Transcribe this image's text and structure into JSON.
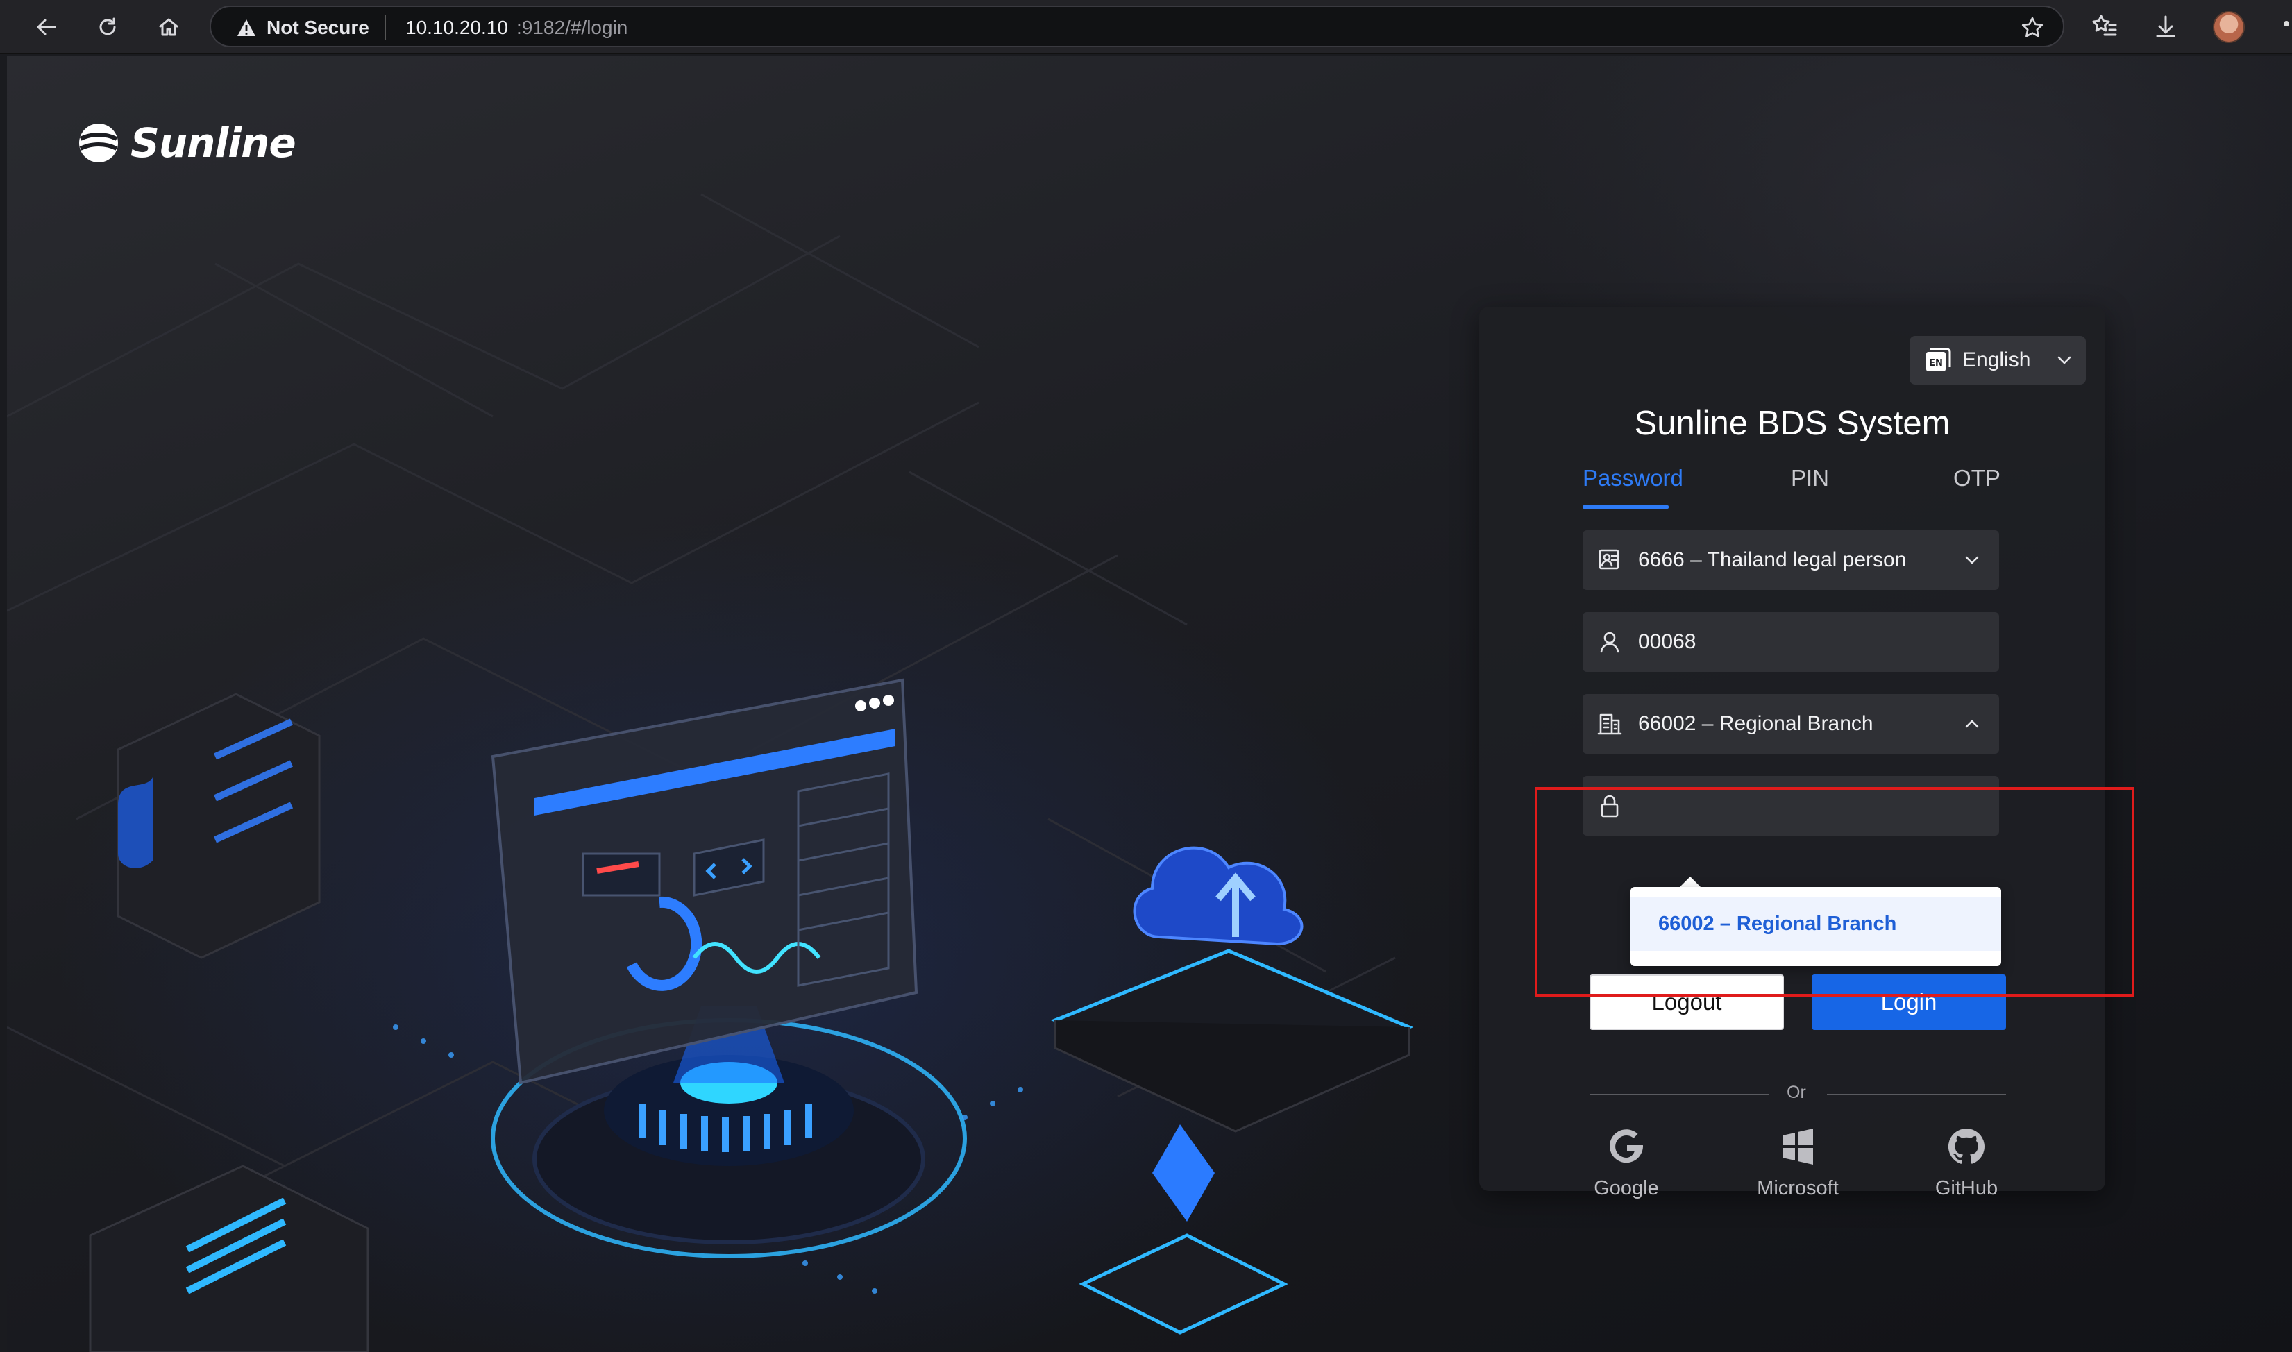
{
  "browser": {
    "security_label": "Not Secure",
    "url_host": "10.10.20.10",
    "url_path": ":9182/#/login"
  },
  "brand": {
    "name": "Sunline"
  },
  "login": {
    "language": "English",
    "language_badge": "EN",
    "title": "Sunline BDS System",
    "tabs": [
      {
        "label": "Password",
        "active": true
      },
      {
        "label": "PIN",
        "active": false
      },
      {
        "label": "OTP",
        "active": false
      }
    ],
    "legal_person": "6666 – Thailand legal person",
    "username": "00068",
    "branch": "66002 – Regional Branch",
    "branch_options": [
      "66002 – Regional Branch"
    ],
    "logout_label": "Logout",
    "login_label": "Login",
    "or_label": "Or",
    "social": [
      {
        "label": "Google",
        "icon": "google-icon"
      },
      {
        "label": "Microsoft",
        "icon": "windows-icon"
      },
      {
        "label": "GitHub",
        "icon": "github-icon"
      }
    ]
  },
  "colors": {
    "accent": "#2e7bf6",
    "login_button": "#1766e6",
    "highlight_box": "#e01b1b",
    "card_bg": "#1e1f24"
  }
}
